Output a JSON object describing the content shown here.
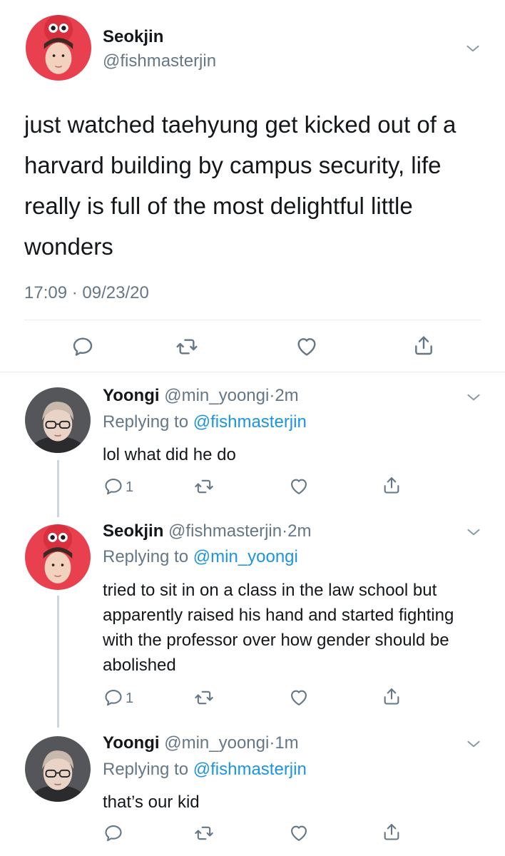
{
  "main_tweet": {
    "author_name": "Seokjin",
    "author_handle": "@fishmasterjin",
    "text": "just watched taehyung get kicked out of a harvard building by campus security, life really is full of the most delightful little wonders",
    "timestamp": "17:09 · 09/23/20",
    "icons": [
      "reply-icon",
      "retweet-icon",
      "like-icon",
      "share-icon"
    ]
  },
  "replies": [
    {
      "author_name": "Yoongi",
      "author_handle": "@min_yoongi",
      "separator": "·",
      "time": "2m",
      "replying_prefix": "Replying to ",
      "replying_to": "@fishmasterjin",
      "text": "lol what did he do",
      "reply_count": "1"
    },
    {
      "author_name": "Seokjin",
      "author_handle": "@fishmasterjin",
      "separator": "·",
      "time": "2m",
      "replying_prefix": "Replying to ",
      "replying_to": "@min_yoongi",
      "text": "tried to sit in on a class in the law school but apparently raised his hand and started fighting with the professor over how gender should be abolished",
      "reply_count": "1"
    },
    {
      "author_name": "Yoongi",
      "author_handle": "@min_yoongi",
      "separator": "·",
      "time": "1m",
      "replying_prefix": "Replying to ",
      "replying_to": "@fishmasterjin",
      "text": "that’s our kid",
      "reply_count": ""
    }
  ],
  "colors": {
    "text": "#14171a",
    "secondary": "#657786",
    "link": "#1b95e0",
    "divider": "#e6ecf0",
    "thread_line": "#ccd6dd"
  }
}
